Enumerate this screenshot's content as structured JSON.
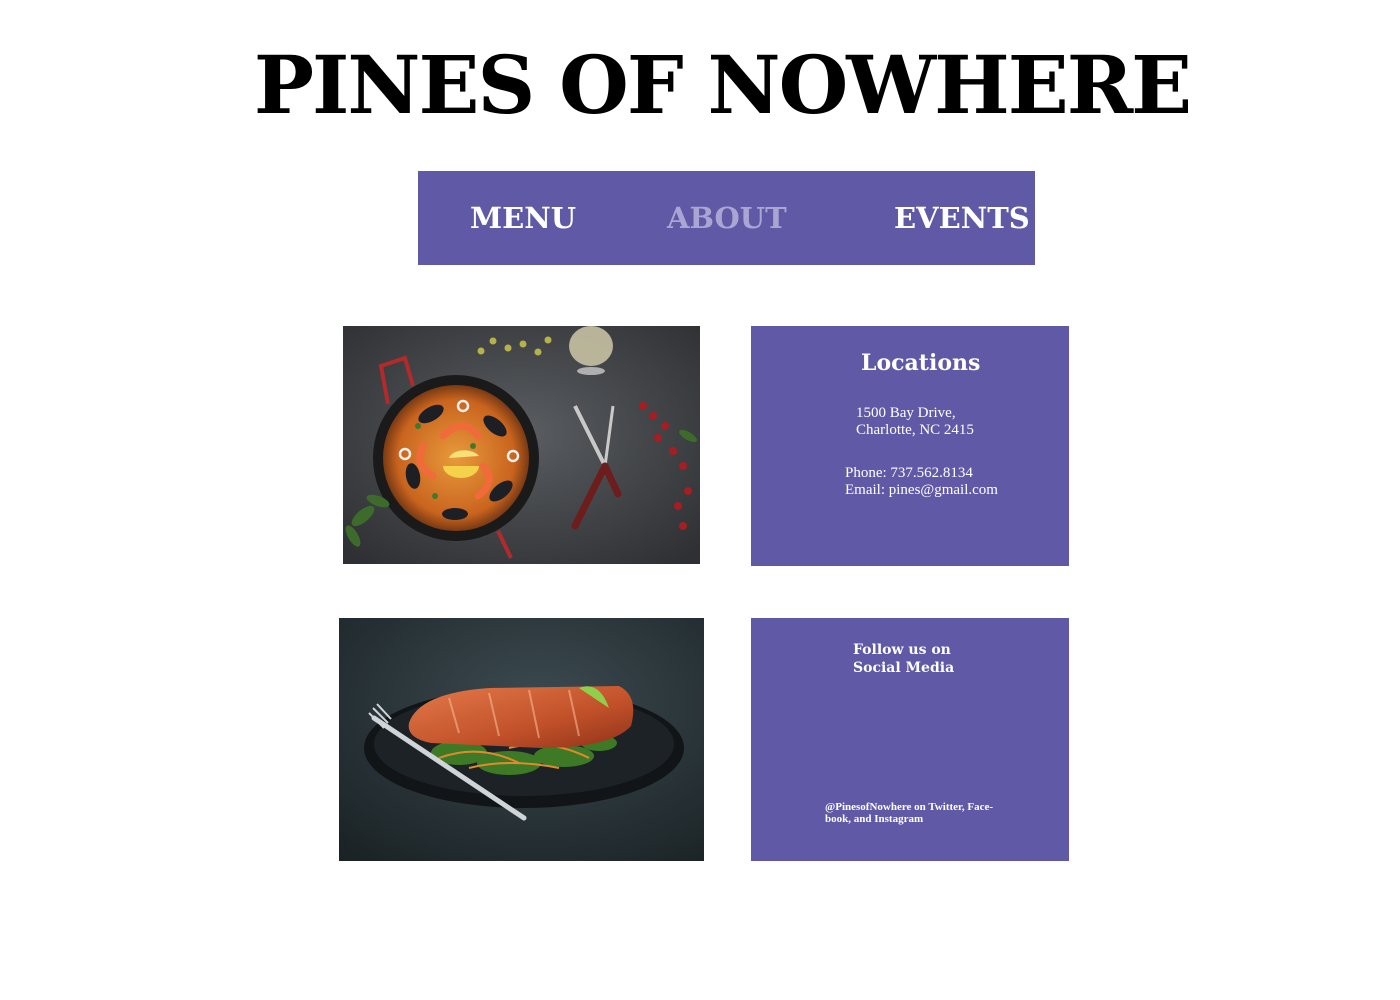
{
  "header": {
    "title": "PINES OF NOWHERE"
  },
  "nav": {
    "items": [
      {
        "label": "MENU"
      },
      {
        "label": "ABOUT"
      },
      {
        "label": "EVENTS"
      }
    ],
    "active": "ABOUT"
  },
  "locations": {
    "title": "Locations",
    "address_line1": "1500 Bay Drive,",
    "address_line2": "Charlotte, NC 2415",
    "phone": "Phone: 737.562.8134",
    "email": "Email: pines@gmail.com"
  },
  "social": {
    "title_line1": "Follow us on",
    "title_line2": "Social Media",
    "handle_line1": "@PinesofNowhere on Twitter, Face-",
    "handle_line2": "book, and Instagram"
  },
  "photos": {
    "top_icon": "paella-photo",
    "bottom_icon": "salmon-photo"
  },
  "colors": {
    "accent": "#5f59a6",
    "nav_active": "#aaa6d3",
    "text_dark": "#000000",
    "text_light": "#ffffff"
  }
}
